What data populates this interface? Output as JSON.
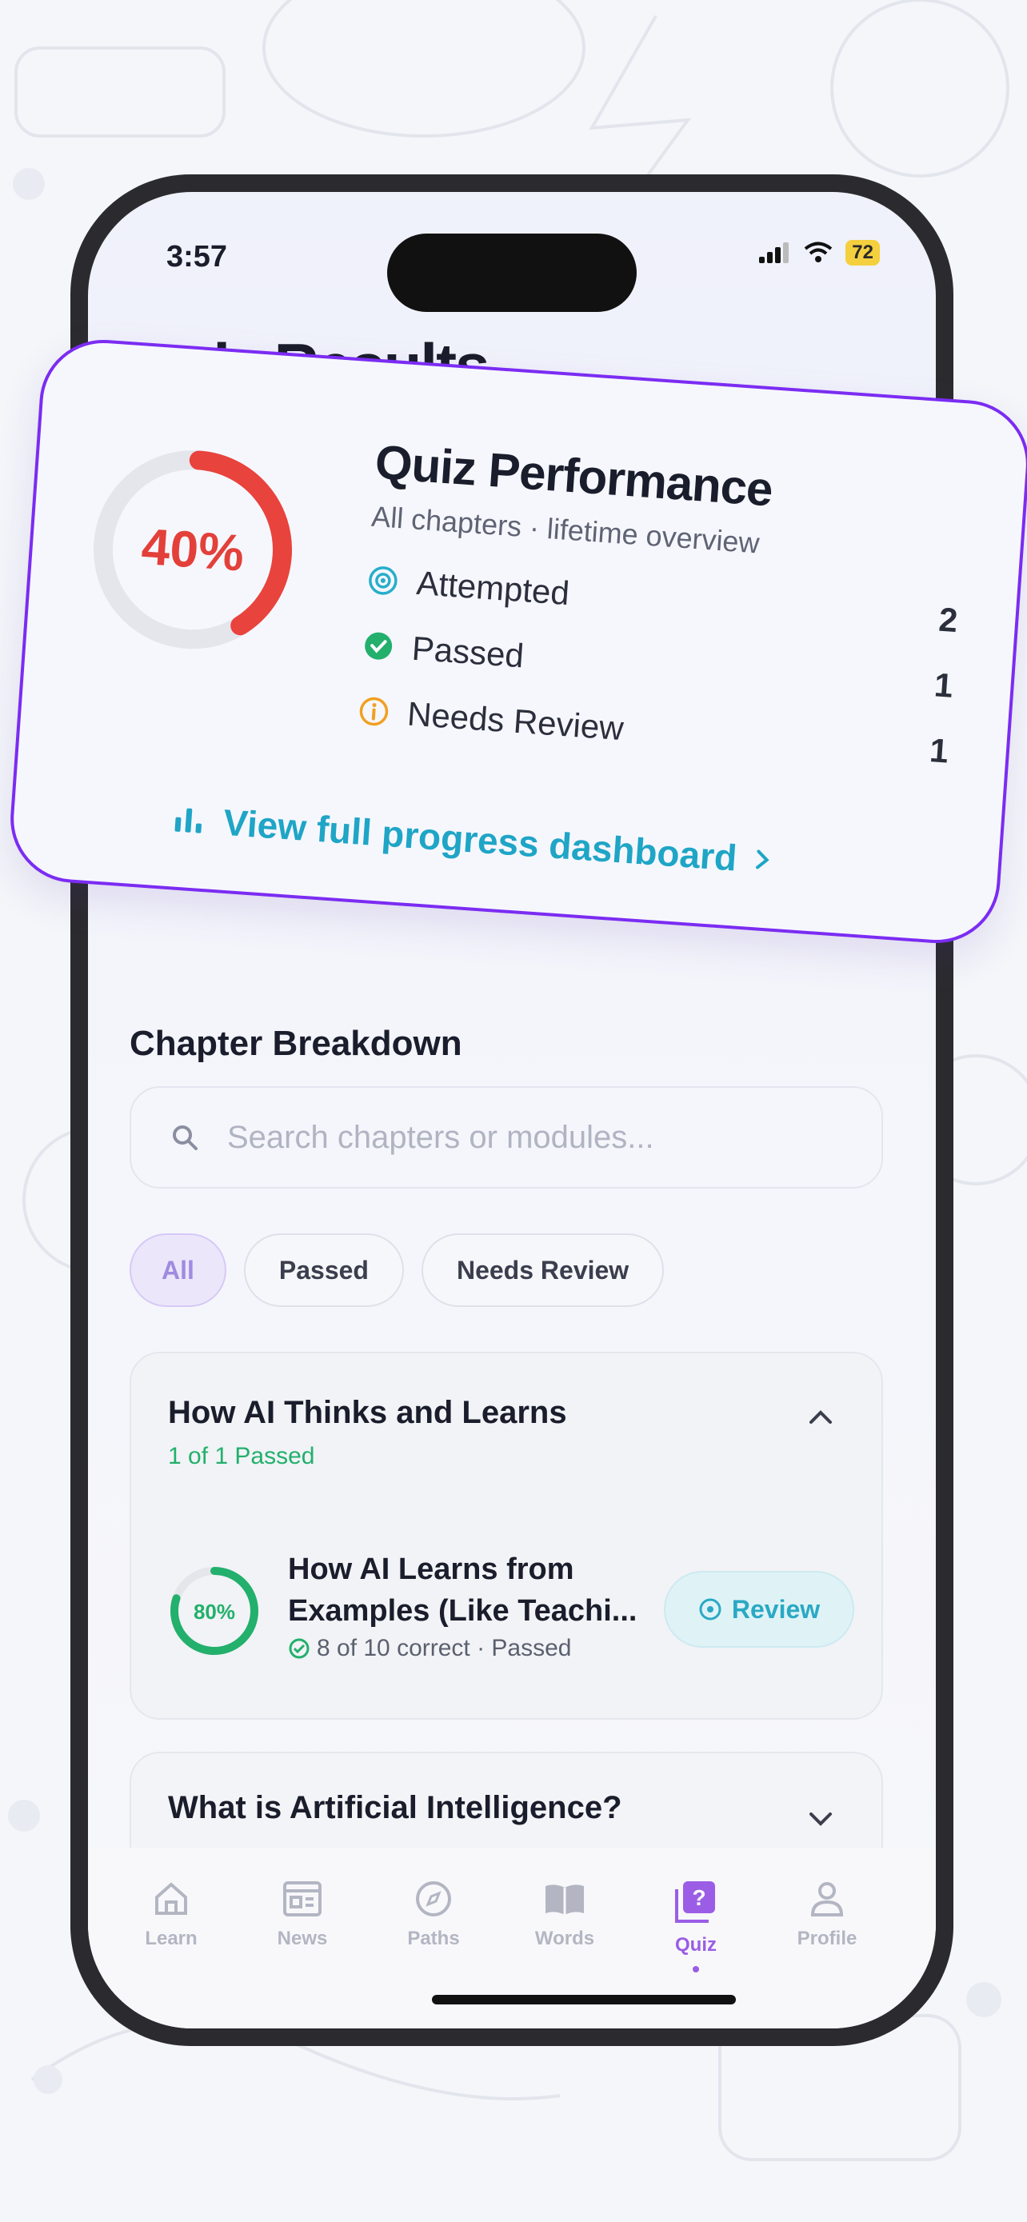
{
  "status_bar": {
    "time": "3:57",
    "battery": "72"
  },
  "page": {
    "title": "Quiz Results",
    "behind_overlay_text": "formance"
  },
  "performance": {
    "percent": "40%",
    "percent_value": 0.4,
    "title": "Quiz Performance",
    "subtitle": "All chapters · lifetime overview",
    "stats": [
      {
        "label": "Attempted",
        "value": "2",
        "icon": "target-icon",
        "color": "#27aecb"
      },
      {
        "label": "Passed",
        "value": "1",
        "icon": "check-circle-icon",
        "color": "#22b06c"
      },
      {
        "label": "Needs Review",
        "value": "1",
        "icon": "info-circle-icon",
        "color": "#f0a020"
      }
    ],
    "link": "View full progress dashboard",
    "ring_color": "#e8433c"
  },
  "breakdown": {
    "title": "Chapter Breakdown",
    "search_placeholder": "Search chapters or modules...",
    "filters": [
      "All",
      "Passed",
      "Needs Review"
    ],
    "chapters": [
      {
        "title": "How AI Thinks and Learns",
        "subtitle": "1 of 1 Passed",
        "module": {
          "title": "How AI Learns from Examples (Like Teachi...",
          "percent": "80%",
          "percent_value": 0.8,
          "meta": "8 of 10 correct · Passed",
          "action": "Review"
        }
      },
      {
        "title": "What is Artificial Intelligence?"
      }
    ]
  },
  "tabs": [
    "Learn",
    "News",
    "Paths",
    "Words",
    "Quiz",
    "Profile"
  ],
  "colors": {
    "accent": "#9b5de5",
    "overlay_border": "#7b2cf2",
    "teal": "#1fa5c6",
    "green": "#22b06c"
  }
}
